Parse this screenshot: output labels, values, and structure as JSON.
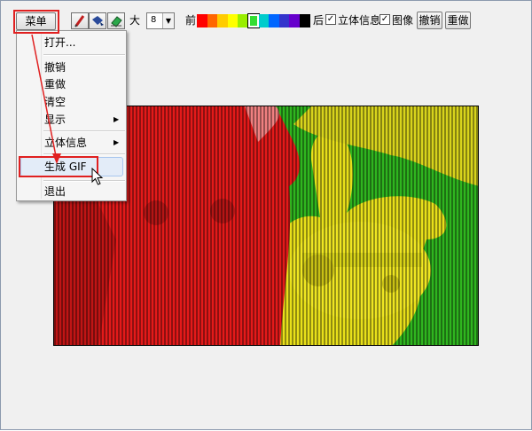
{
  "toolbar": {
    "menu_label": "菜单",
    "size_label": "大",
    "size_value": "8",
    "front_label": "前",
    "back_label": "后",
    "stereo_check_label": "立体信息",
    "image_check_label": "图像",
    "undo_label": "撤销",
    "redo_label": "重做",
    "stereo_checked": true,
    "image_checked": true,
    "tools": [
      "pencil-icon",
      "paint-bucket-icon",
      "eraser-icon"
    ],
    "palette": [
      "#ff0000",
      "#ff6600",
      "#ffcc00",
      "#ffff00",
      "#99ee00",
      "#33dd33",
      "#00cccc",
      "#0066ff",
      "#3333cc",
      "#6600cc",
      "#000000"
    ]
  },
  "menu": {
    "items": [
      {
        "label": "打开..."
      },
      {
        "label": "撤销"
      },
      {
        "label": "重做"
      },
      {
        "label": "清空"
      },
      {
        "label": "显示",
        "submenu": true
      },
      {
        "label": "立体信息",
        "submenu": true
      },
      {
        "label": "生成 GIF",
        "highlighted": true
      },
      {
        "label": "退出"
      }
    ]
  },
  "colors": {
    "annotation_red": "#e02020",
    "menu_highlight": "#e3ecf8",
    "canvas_red": "#e01818",
    "canvas_yellow": "#e6e020",
    "canvas_green": "#33bb22"
  }
}
